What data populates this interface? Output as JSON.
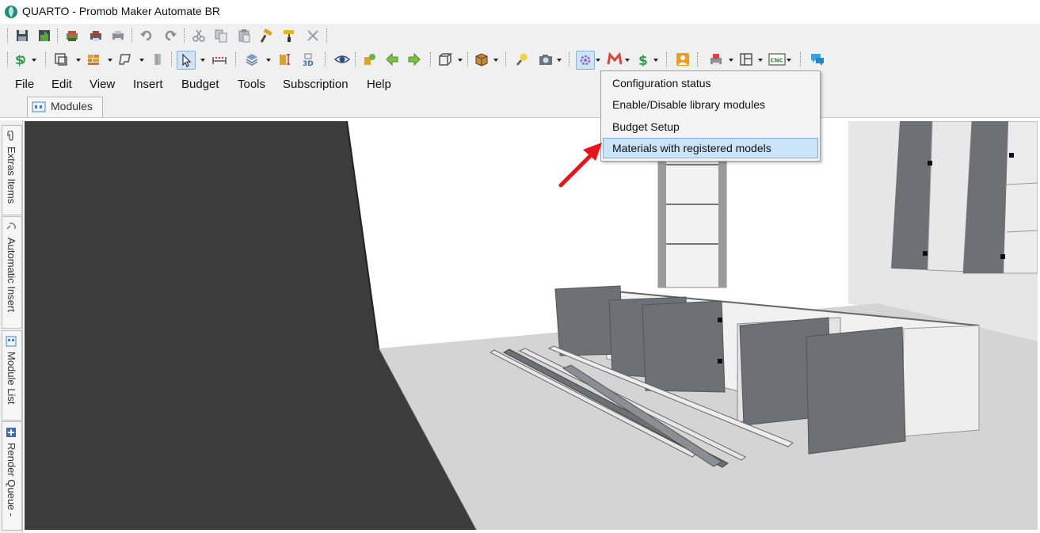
{
  "window": {
    "title": "QUARTO - Promob Maker Automate BR"
  },
  "menubar": {
    "items": [
      "File",
      "Edit",
      "View",
      "Insert",
      "Budget",
      "Tools",
      "Subscription",
      "Help"
    ]
  },
  "tabs": {
    "modules_label": "Modules"
  },
  "side_tabs": [
    "Extras Items",
    "Automatic Insert",
    "Module List",
    "Render Queue -"
  ],
  "context_menu": {
    "items": [
      "Configuration status",
      "Enable/Disable library modules",
      "Budget Setup",
      "Materials with registered models"
    ],
    "highlighted_index": 3
  },
  "toolbar": {
    "row1_icons": [
      "save-icon",
      "save-as-icon",
      "open-icon",
      "print-icon",
      "print-preview-icon",
      "undo-icon",
      "redo-icon",
      "cut-icon",
      "copy-icon",
      "paste-icon",
      "hammer-icon",
      "paint-roller-icon",
      "delete-icon"
    ],
    "row2_icons": [
      "budget-dollar-icon",
      "plan-view-icon",
      "bricks-icon",
      "shape-icon",
      "column-icon",
      "select-cursor-icon",
      "measure-icon",
      "layers-icon",
      "dimension-icon",
      "3d-view-icon",
      "eye-icon",
      "move-icon",
      "arrow-left-icon",
      "arrow-right-icon",
      "cube-frame-icon",
      "box-icon",
      "light-bulb-icon",
      "camera-icon",
      "gear-settings-icon",
      "m-logo-icon",
      "dollar-icon",
      "user-icon",
      "pdf-print-icon",
      "layout-icon",
      "cnc-icon",
      "chat-icon"
    ],
    "cnc_label": "CNC",
    "view3d_label": "3D"
  },
  "colors": {
    "toolbar_bg": "#f0f0f0",
    "highlight": "#cce4f7",
    "door_gray": "#6d7074",
    "floor": "#d6d6d6",
    "wall_dark": "#3d3d3d",
    "arrow_red": "#e8141c"
  }
}
